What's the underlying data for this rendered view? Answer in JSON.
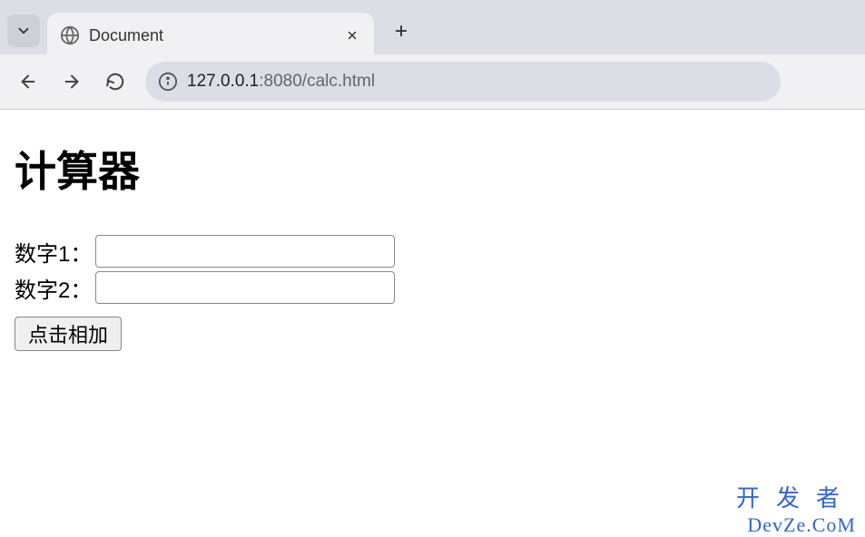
{
  "browser": {
    "tab_title": "Document",
    "url_host": "127.0.0.1",
    "url_path": ":8080/calc.html"
  },
  "page": {
    "heading": "计算器",
    "label1": "数字1：",
    "label2": "数字2：",
    "button_label": "点击相加"
  },
  "watermark": {
    "line1": "开发者",
    "line2": "DevZe.CoM"
  }
}
